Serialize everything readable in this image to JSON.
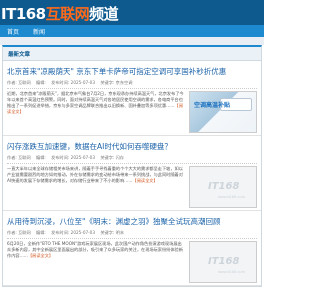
{
  "header": {
    "logo_prefix": "IT168",
    "logo_highlight": "互联网",
    "logo_suffix": "频道"
  },
  "nav": {
    "items": [
      "首页",
      "新闻"
    ]
  },
  "tabs": {
    "active": "最新文章"
  },
  "articles": [
    {
      "title": "北京首来\"凉殿荫天\" 京东下单卡萨帝可指定空调可享国补秒折优惠",
      "meta": [
        "作者: 互联网",
        "编辑: ",
        "发布时间: 2025-07-03",
        "关键字: 京东空调"
      ],
      "summary": "近期，北京首来\"凉殿荫天\"，据北京市气象台7月2日，京东现承办持续高温天气，北京发布了今年以来首个高温红色预警。同时，面对持续高温天气对各地居民使用空调的需求，各电商平台也推出了一系列促进举措，京东与多家空调品牌联合推出以旧换新、国补叠加等多项优惠……",
      "more": "【阅读全文】",
      "thumb_text": "空调高温补贴"
    },
    {
      "title": "闪存涨跌互加速键，数据在AI时代如何吞噬硬盘？",
      "meta": [
        "作者: 互联网",
        "编辑: ",
        "发布时间: 2025-07-03",
        "关键字: 闪存"
      ],
      "summary": "一直大半年以来全球存储相关市场来讲，随着手手寻找着重的个个大大的需求都呈走下坡，如以产业链需要剧烈的地方如何推动，外在存储需求的变动给市场带来一系列挑战，与此同时随着对AI快速的发展下存储需求的增长，对存储行业带来了不小的影响……",
      "more": "【阅读全文】",
      "thumb_logo": "IT168",
      "thumb_sub": "www.it168.com"
    },
    {
      "title": "从用待到沉浸，八位至\"《明末：渊虚之羽》独聚全试玩高潮回顾",
      "meta": [
        "作者: 互联网",
        "编辑: ",
        "发布时间: 2025-07-03",
        "关键字: 明末"
      ],
      "summary": "6月20日，全新作\"BTO THE MOON\"游戏玩家展区现场，此次国产动作角色扮演游戏现场展出众多新内容，其中全新展区里面展出的部分，吸引来了众多玩家的关注，在现场玩家纷纷体验新作内容……",
      "more": "【阅读全文】",
      "thumb_logo": "IT168",
      "thumb_sub": "www.it168.com"
    }
  ],
  "colors": {
    "header_bg": "#0e5a8f",
    "nav_bg": "#1d8ad0",
    "title_link": "#1a62a8",
    "logo_accent": "#ff6a1a"
  }
}
